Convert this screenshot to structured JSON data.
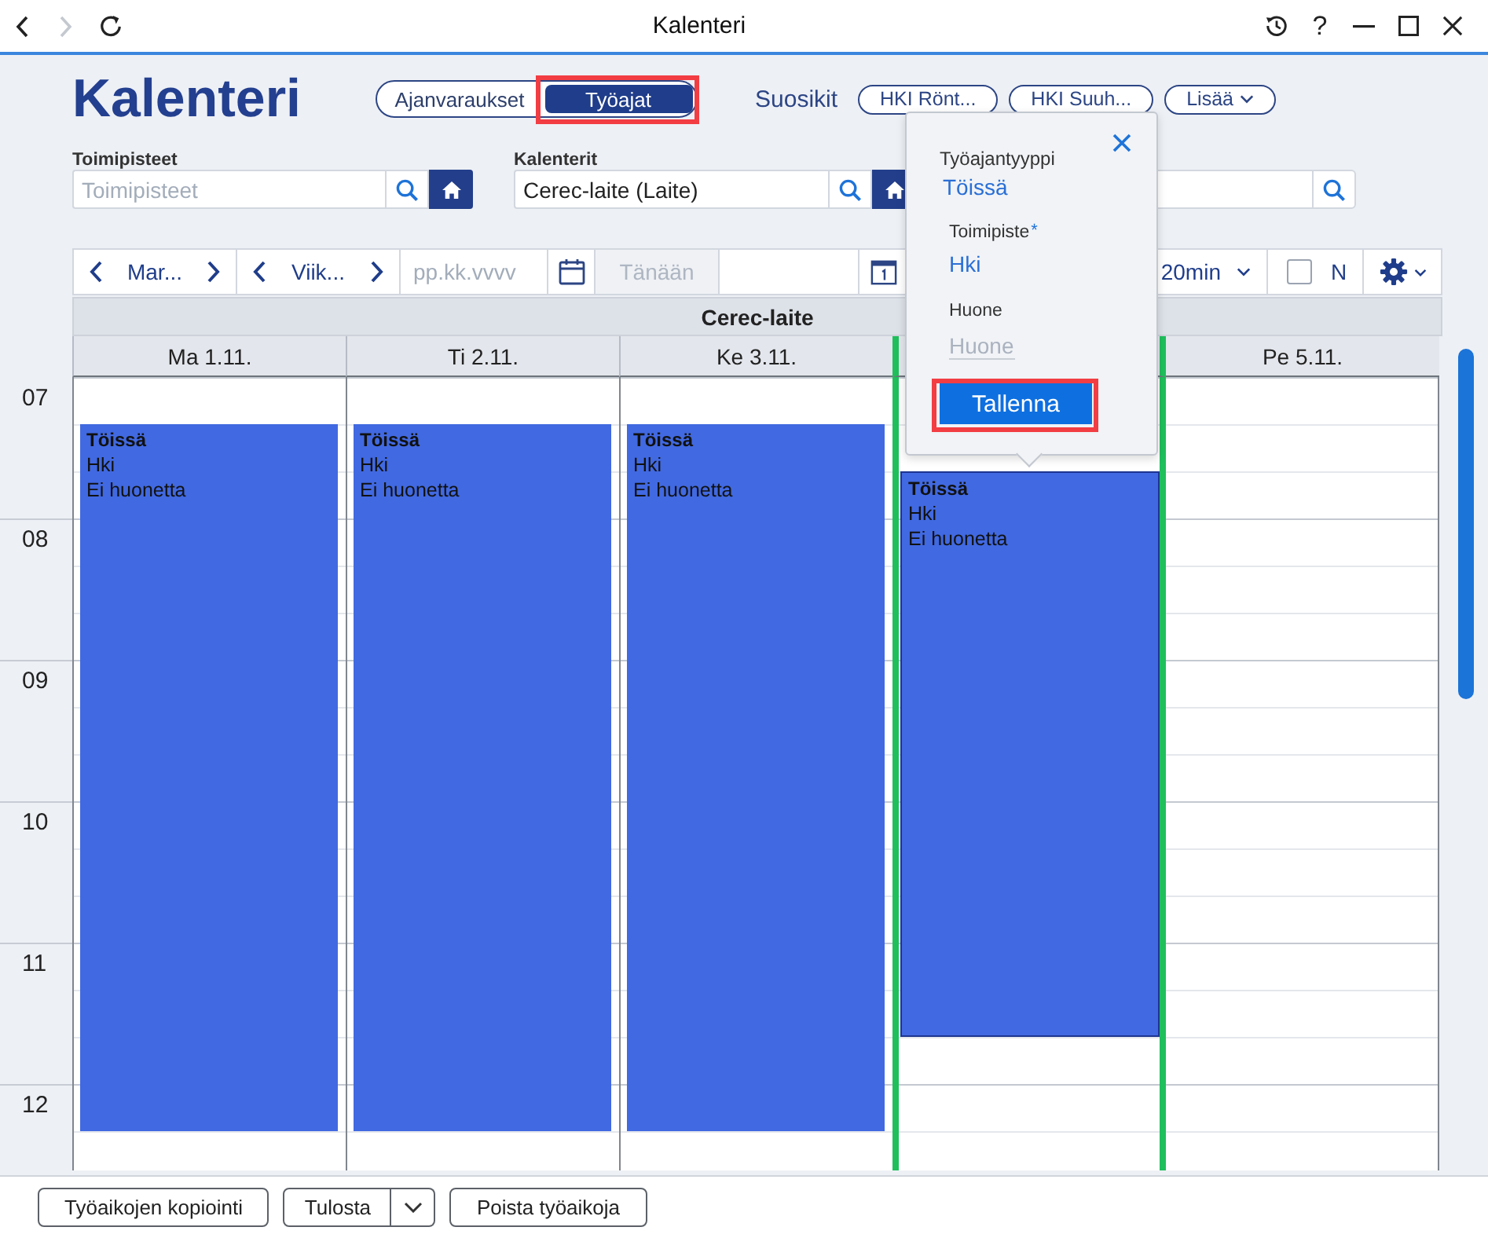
{
  "window": {
    "title": "Kalenteri",
    "nav_buttons": [
      {
        "kind": "back",
        "disabled": false
      },
      {
        "kind": "forward",
        "disabled": true
      },
      {
        "kind": "refresh",
        "disabled": false
      }
    ],
    "help_label": "?"
  },
  "header": {
    "title": "Kalenteri",
    "modes": [
      {
        "label": "Ajanvaraukset",
        "selected": false,
        "highlighted": false
      },
      {
        "label": "Työajat",
        "selected": true,
        "highlighted": true
      }
    ],
    "favorites_label": "Suosikit",
    "favorites": [
      {
        "label": "HKI Rönt...",
        "dropdown": false
      },
      {
        "label": "HKI Suuh...",
        "dropdown": false
      },
      {
        "label": "Lisää",
        "dropdown": true
      }
    ]
  },
  "filters": [
    {
      "label": "Toimipisteet",
      "placeholder": "Toimipisteet",
      "home_button": true
    },
    {
      "label": "Kalenterit",
      "value": "Cerec-laite (Laite)",
      "home_button": true
    },
    {
      "home_button": false
    }
  ],
  "toolbar": {
    "month": "Mar...",
    "week": "Viik...",
    "date_placeholder": "pp.kk.vvvv",
    "today_button": {
      "label": "Tänään",
      "disabled": true
    },
    "interval": "20min",
    "checkbox": {
      "label": "N",
      "checked": false
    }
  },
  "calendar": {
    "resource": "Cerec-laite",
    "hours": [
      "07",
      "08",
      "09",
      "10",
      "11",
      "12"
    ],
    "days": [
      {
        "label": "Ma 1.11.",
        "today": false,
        "events": [
          {
            "title": "Töissä",
            "location": "Hki",
            "room": "Ei huonetta",
            "selected": false
          }
        ]
      },
      {
        "label": "Ti 2.11.",
        "today": false,
        "events": [
          {
            "title": "Töissä",
            "location": "Hki",
            "room": "Ei huonetta",
            "selected": false
          }
        ]
      },
      {
        "label": "Ke 3.11.",
        "today": false,
        "events": [
          {
            "title": "Töissä",
            "location": "Hki",
            "room": "Ei huonetta",
            "selected": false
          }
        ]
      },
      {
        "today": true,
        "events": [
          {
            "title": "Töissä",
            "location": "Hki",
            "room": "Ei huonetta",
            "selected": true
          }
        ]
      },
      {
        "label": "Pe 5.11.",
        "today": false
      }
    ]
  },
  "popover": {
    "fields": [
      {
        "label": "Työajantyyppi",
        "value": "Töissä"
      },
      {
        "label": "Toimipiste",
        "required_mark": "*",
        "value": "Hki"
      },
      {
        "label": "Huone",
        "placeholder": "Huone"
      }
    ],
    "save_button": {
      "label": "Tallenna",
      "highlighted": true
    }
  },
  "footer": {
    "buttons": [
      {
        "label": "Työaikojen kopiointi",
        "kind": "plain"
      },
      {
        "label": "Tulosta",
        "kind": "split"
      },
      {
        "label": "Poista työaikoja",
        "kind": "plain"
      }
    ]
  }
}
